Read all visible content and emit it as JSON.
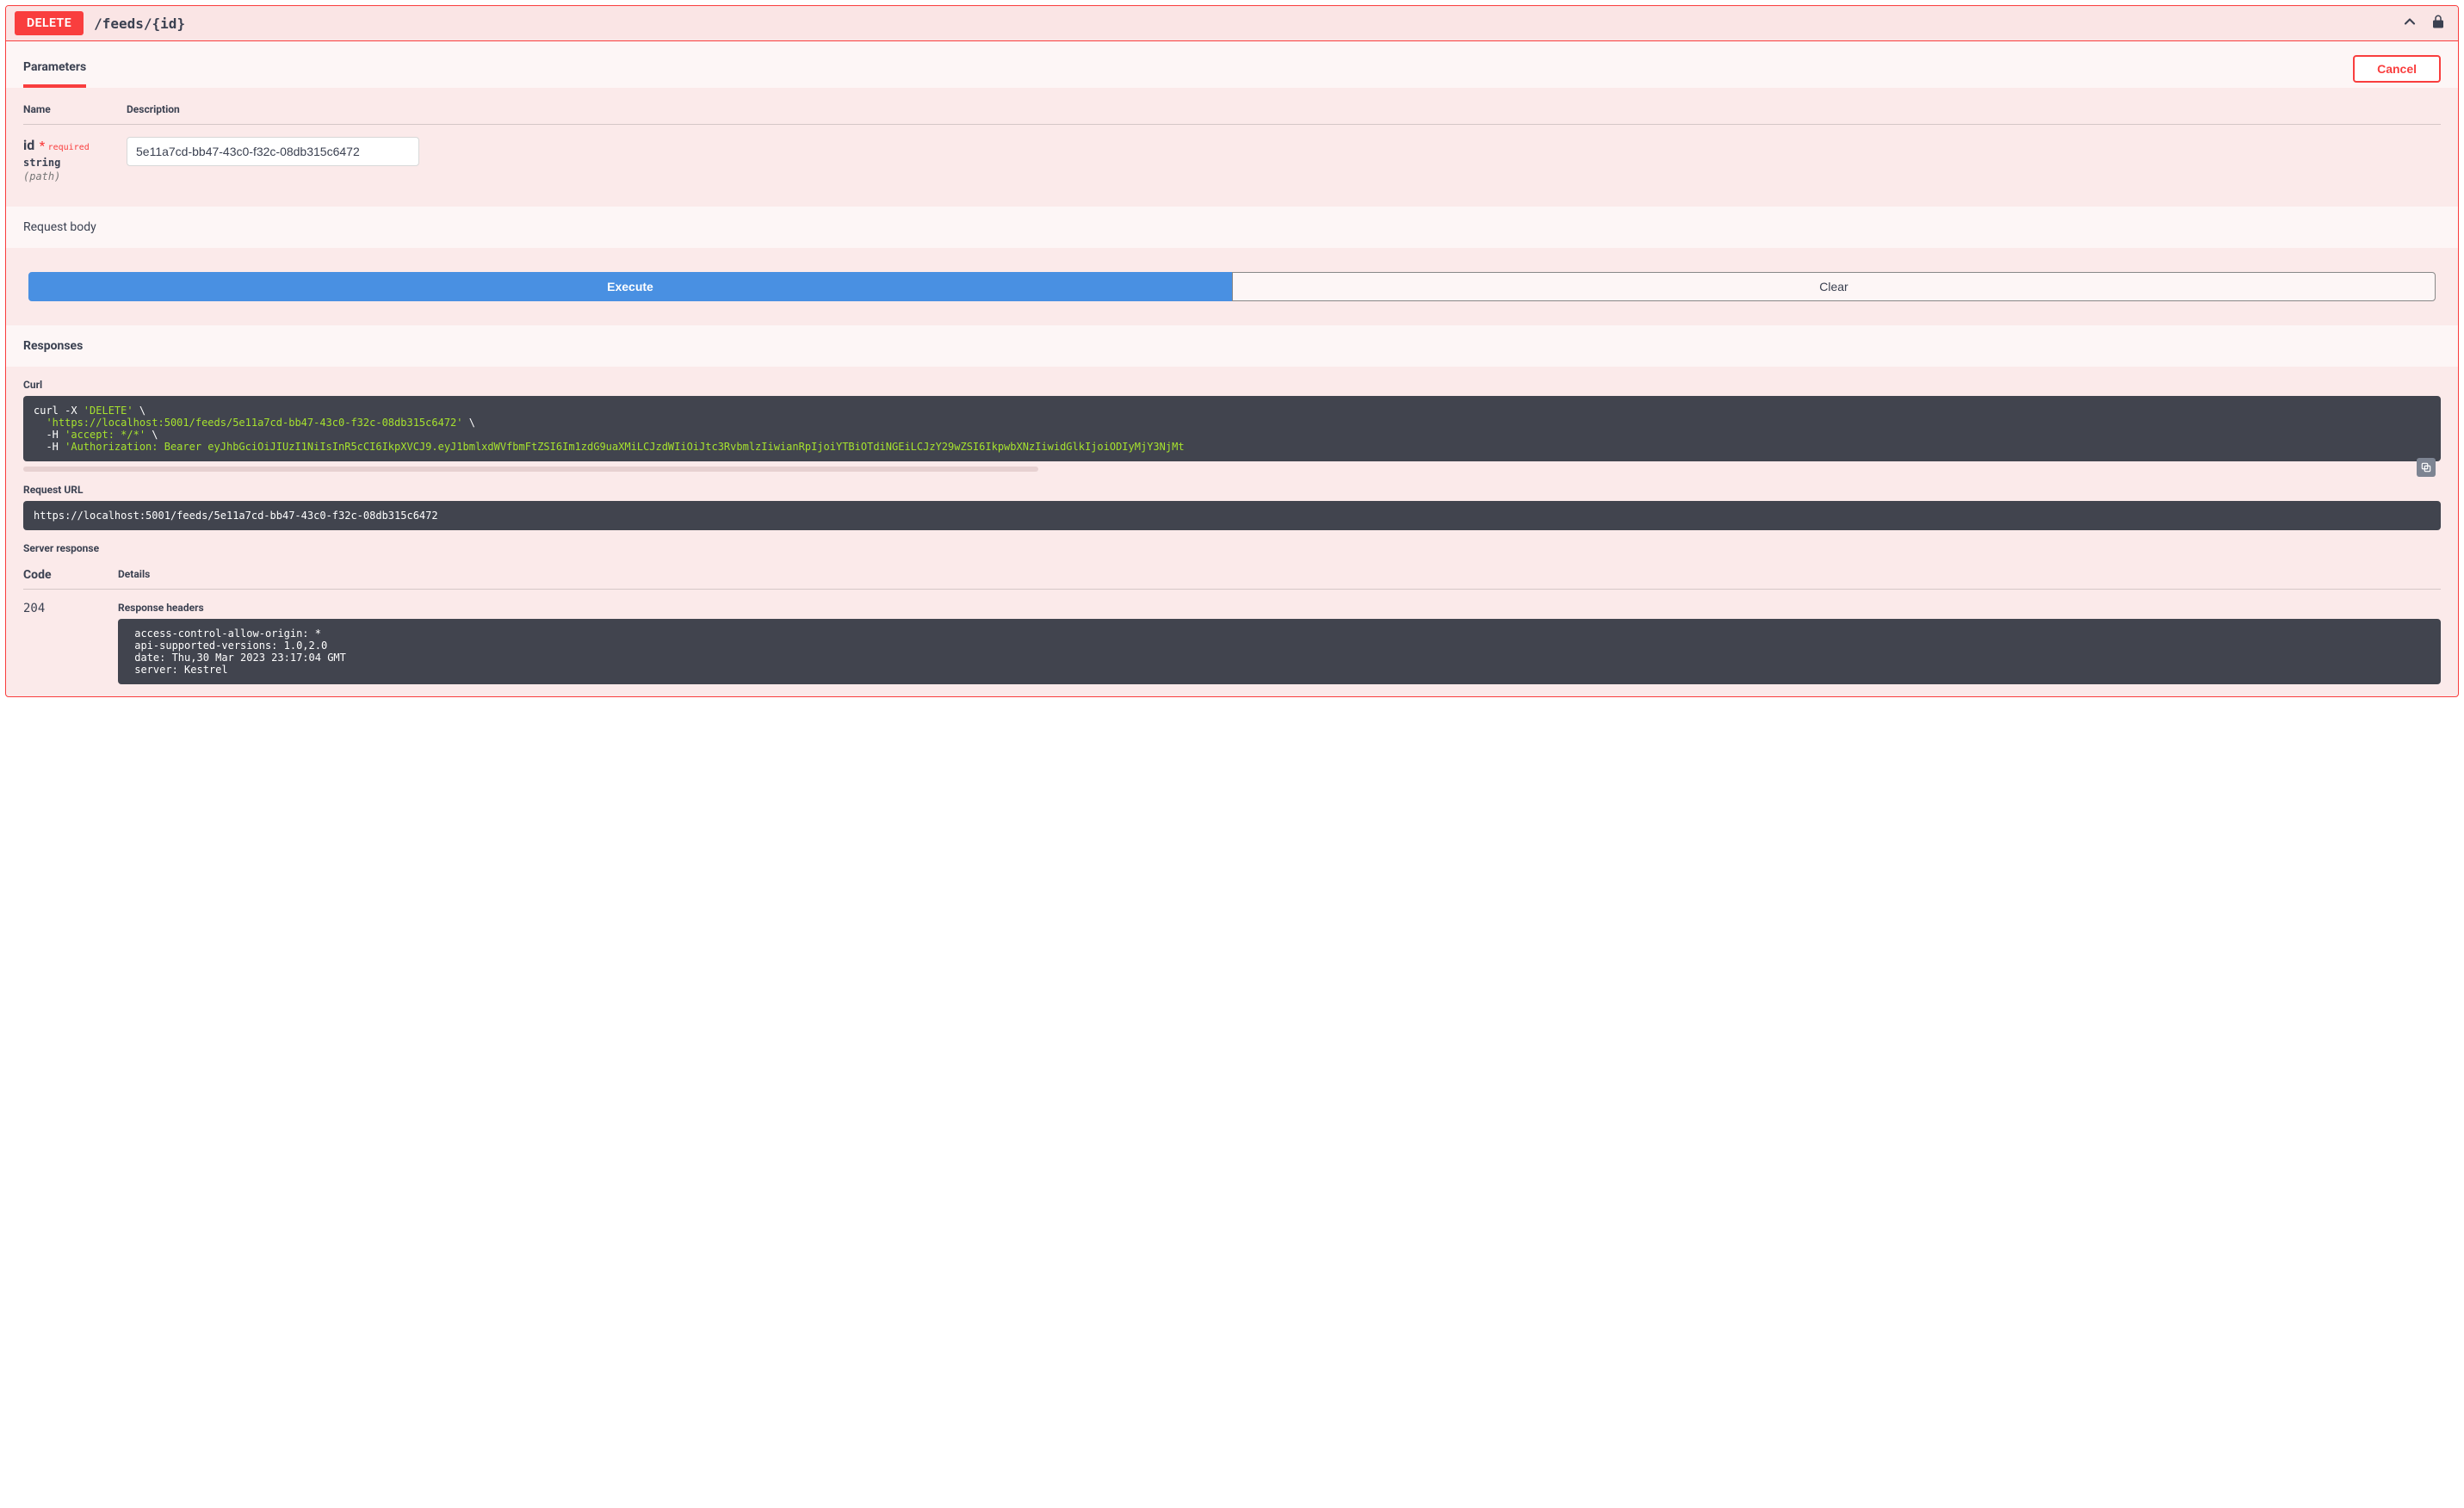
{
  "summary": {
    "method": "DELETE",
    "path": "/feeds/{id}"
  },
  "sections": {
    "parameters_tab": "Parameters",
    "cancel_label": "Cancel",
    "col_name": "Name",
    "col_description": "Description",
    "request_body_label": "Request body",
    "responses_label": "Responses",
    "curl_label": "Curl",
    "request_url_label": "Request URL",
    "server_response_label": "Server response",
    "code_col": "Code",
    "details_col": "Details",
    "response_headers_label": "Response headers"
  },
  "param": {
    "name": "id",
    "required_star": "*",
    "required_text": "required",
    "type": "string",
    "in": "(path)",
    "value": "5e11a7cd-bb47-43c0-f32c-08db315c6472"
  },
  "buttons": {
    "execute": "Execute",
    "clear": "Clear"
  },
  "curl": {
    "l1a": "curl -X ",
    "l1b": "'DELETE'",
    "l1c": " \\",
    "l2a": "  ",
    "l2b": "'https://localhost:5001/feeds/5e11a7cd-bb47-43c0-f32c-08db315c6472'",
    "l2c": " \\",
    "l3a": "  -H ",
    "l3b": "'accept: */*'",
    "l3c": " \\",
    "l4a": "  -H ",
    "l4b": "'Authorization: Bearer eyJhbGciOiJIUzI1NiIsInR5cCI6IkpXVCJ9.eyJ1bmlxdWVfbmFtZSI6Im1zdG9uaXMiLCJzdWIiOiJtc3RvbmlzIiwianRpIjoiYTBiOTdiNGEiLCJzY29wZSI6IkpwbXNzIiwidGlkIjoiODIyMjY3NjMt"
  },
  "request_url": "https://localhost:5001/feeds/5e11a7cd-bb47-43c0-f32c-08db315c6472",
  "response": {
    "code": "204",
    "headers": " access-control-allow-origin: *\n api-supported-versions: 1.0,2.0\n date: Thu,30 Mar 2023 23:17:04 GMT\n server: Kestrel"
  }
}
